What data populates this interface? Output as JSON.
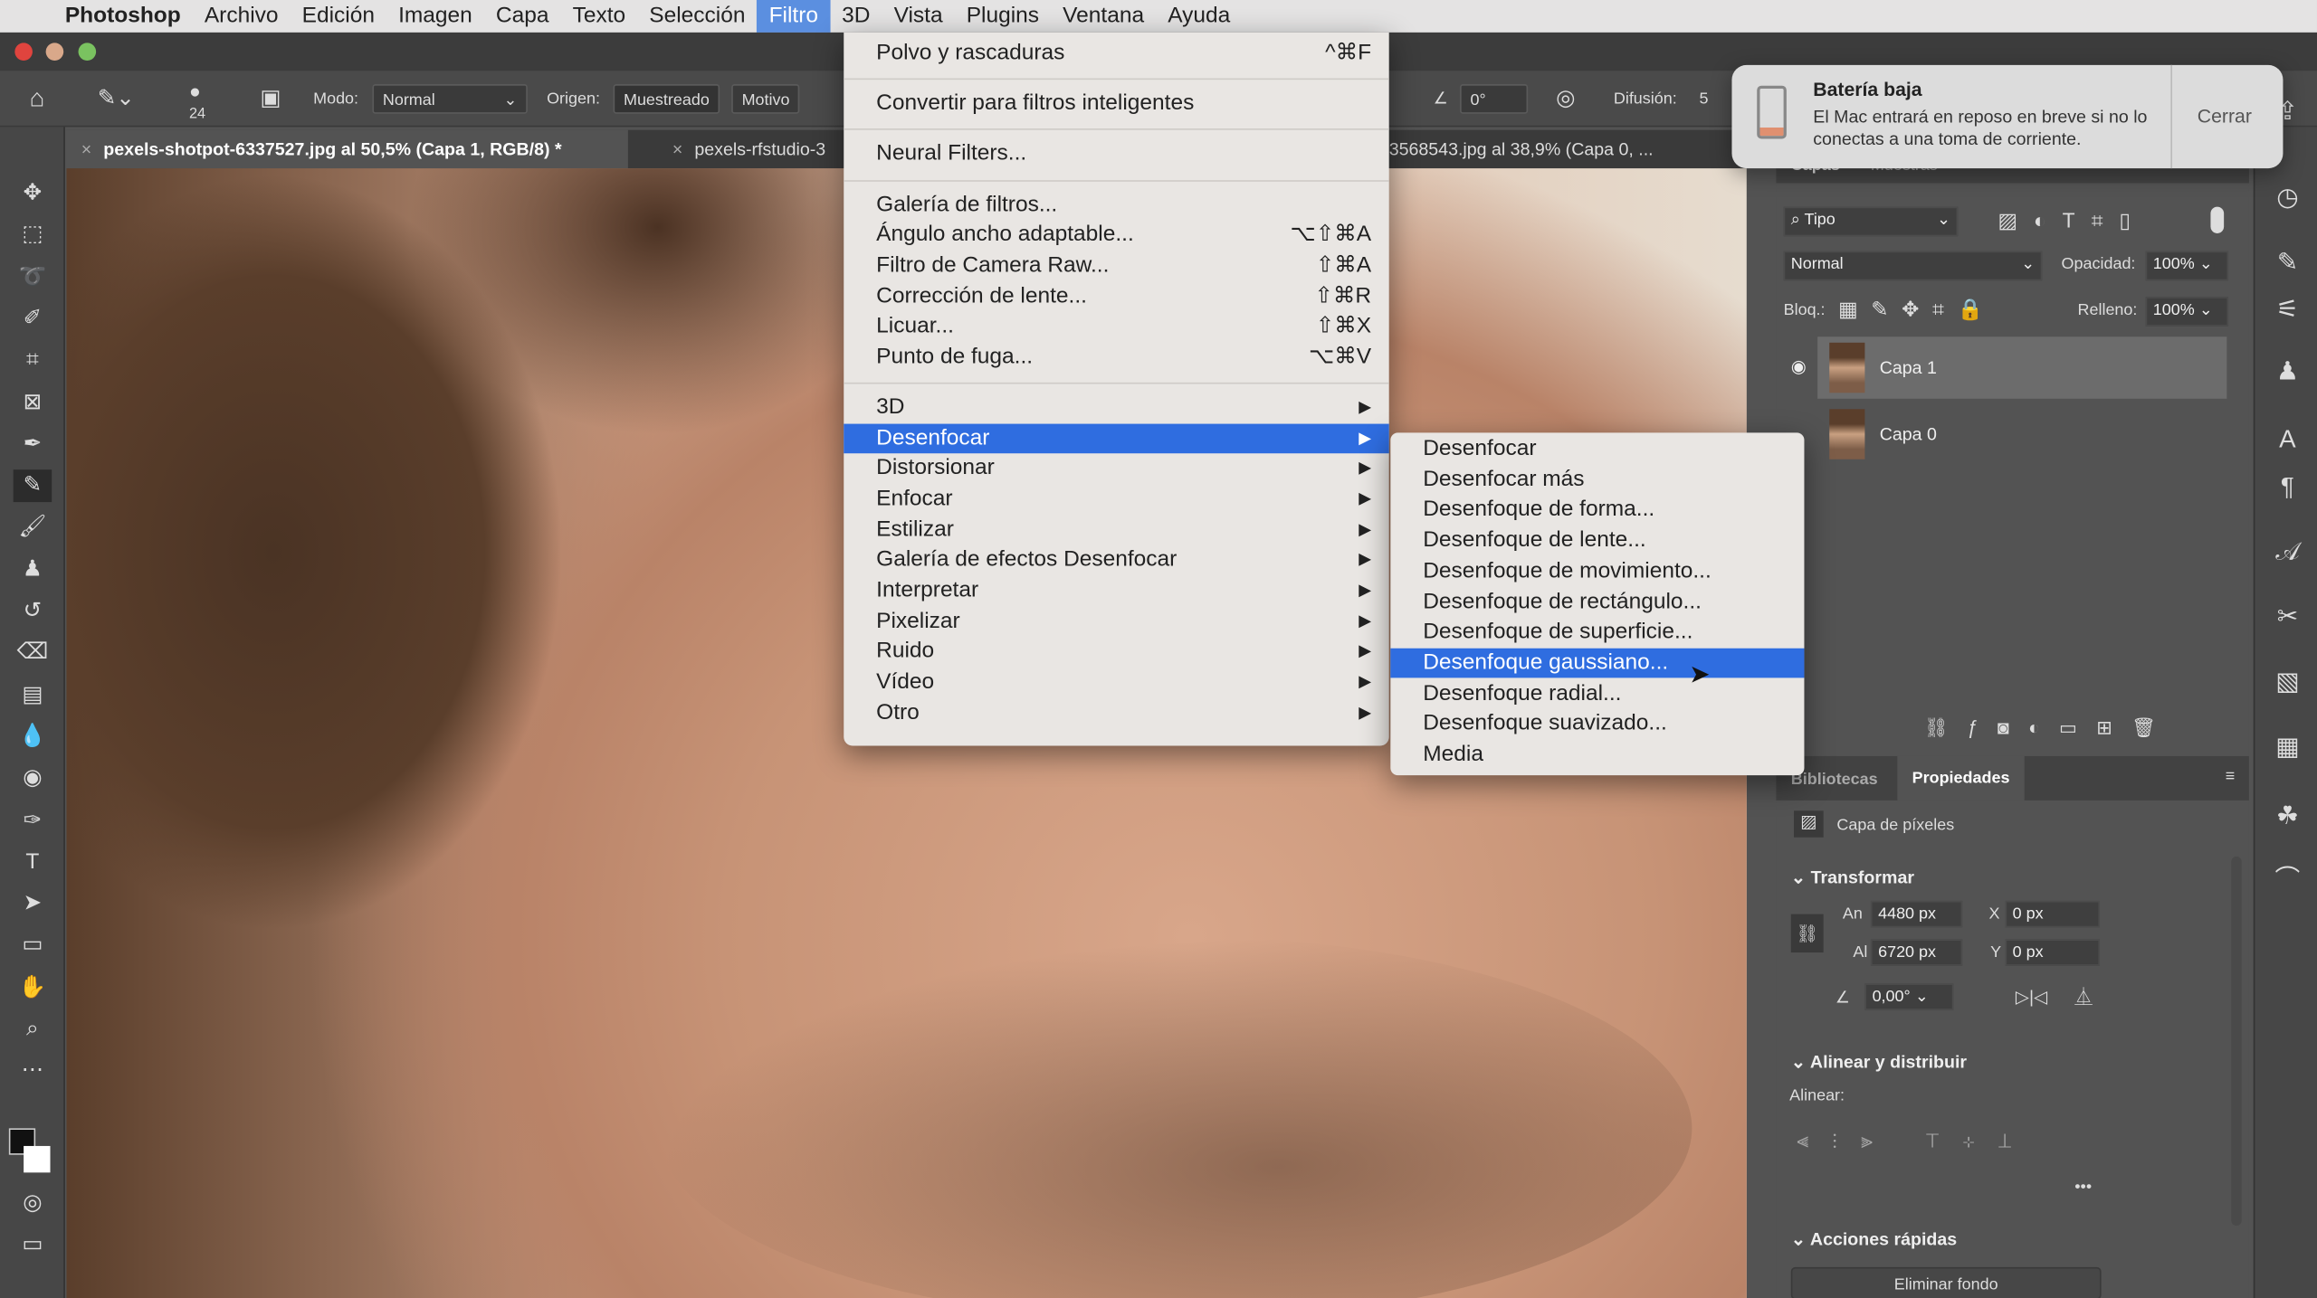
{
  "menubar": {
    "apple": "",
    "items": [
      "Photoshop",
      "Archivo",
      "Edición",
      "Imagen",
      "Capa",
      "Texto",
      "Selección",
      "Filtro",
      "3D",
      "Vista",
      "Plugins",
      "Ventana",
      "Ayuda"
    ],
    "active": "Filtro"
  },
  "options": {
    "size": "24",
    "mode_label": "Modo:",
    "mode_value": "Normal",
    "origin_label": "Origen:",
    "origin_sampled": "Muestreado",
    "origin_pattern": "Motivo",
    "angle": "0°",
    "diffusion_label": "Difusión:",
    "diffusion_value": "5"
  },
  "tabs": [
    {
      "label": "pexels-shotpot-6337527.jpg al 50,5% (Capa 1, RGB/8) *",
      "active": true
    },
    {
      "label": "pexels-rfstudio-3",
      "active": false
    },
    {
      "label": "3568543.jpg al 38,9% (Capa 0, ...",
      "active": false
    }
  ],
  "filter_menu": {
    "items": [
      {
        "label": "Polvo y rascaduras",
        "shortcut": "^⌘F"
      },
      {
        "sep": true
      },
      {
        "label": "Convertir para filtros inteligentes"
      },
      {
        "sep": true
      },
      {
        "label": "Neural Filters..."
      },
      {
        "sep": true
      },
      {
        "label": "Galería de filtros..."
      },
      {
        "label": "Ángulo ancho adaptable...",
        "shortcut": "⌥⇧⌘A"
      },
      {
        "label": "Filtro de Camera Raw...",
        "shortcut": "⇧⌘A"
      },
      {
        "label": "Corrección de lente...",
        "shortcut": "⇧⌘R"
      },
      {
        "label": "Licuar...",
        "shortcut": "⇧⌘X"
      },
      {
        "label": "Punto de fuga...",
        "shortcut": "⌥⌘V"
      },
      {
        "sep": true
      },
      {
        "label": "3D",
        "submenu": true
      },
      {
        "label": "Desenfocar",
        "submenu": true,
        "highlighted": true
      },
      {
        "label": "Distorsionar",
        "submenu": true
      },
      {
        "label": "Enfocar",
        "submenu": true
      },
      {
        "label": "Estilizar",
        "submenu": true
      },
      {
        "label": "Galería de efectos Desenfocar",
        "submenu": true
      },
      {
        "label": "Interpretar",
        "submenu": true
      },
      {
        "label": "Pixelizar",
        "submenu": true
      },
      {
        "label": "Ruido",
        "submenu": true
      },
      {
        "label": "Vídeo",
        "submenu": true
      },
      {
        "label": "Otro",
        "submenu": true
      }
    ]
  },
  "blur_submenu": {
    "items": [
      "Desenfocar",
      "Desenfocar más",
      "Desenfoque de forma...",
      "Desenfoque de lente...",
      "Desenfoque de movimiento...",
      "Desenfoque de rectángulo...",
      "Desenfoque de superficie...",
      "Desenfoque gaussiano...",
      "Desenfoque radial...",
      "Desenfoque suavizado...",
      "Media"
    ],
    "highlighted": "Desenfoque gaussiano..."
  },
  "notification": {
    "title": "Batería baja",
    "body": "El Mac entrará en reposo en breve si no lo conectas a una toma de corriente.",
    "close": "Cerrar"
  },
  "layers_panel": {
    "tabs": [
      "Capas",
      "Muestras"
    ],
    "filter": "Tipo",
    "blend": "Normal",
    "opacity_label": "Opacidad:",
    "opacity": "100%",
    "lock_label": "Bloq.:",
    "fill_label": "Relleno:",
    "fill": "100%",
    "layers": [
      {
        "name": "Capa 1",
        "visible": true,
        "selected": true
      },
      {
        "name": "Capa 0",
        "visible": false,
        "selected": false
      }
    ]
  },
  "properties_panel": {
    "tabs": [
      "Bibliotecas",
      "Propiedades"
    ],
    "active_tab": "Propiedades",
    "kind": "Capa de píxeles",
    "transform_title": "Transformar",
    "w_label": "An",
    "w": "4480 px",
    "h_label": "Al",
    "h": "6720 px",
    "x_label": "X",
    "x": "0 px",
    "y_label": "Y",
    "y": "0 px",
    "angle": "0,00°",
    "align_title": "Alinear y distribuir",
    "align_label": "Alinear:",
    "more": "•••",
    "quick_title": "Acciones rápidas",
    "remove_bg": "Eliminar fondo"
  },
  "colors": {
    "menu_highlight": "#2f6de0",
    "filter_active": "#5b8fe0"
  }
}
